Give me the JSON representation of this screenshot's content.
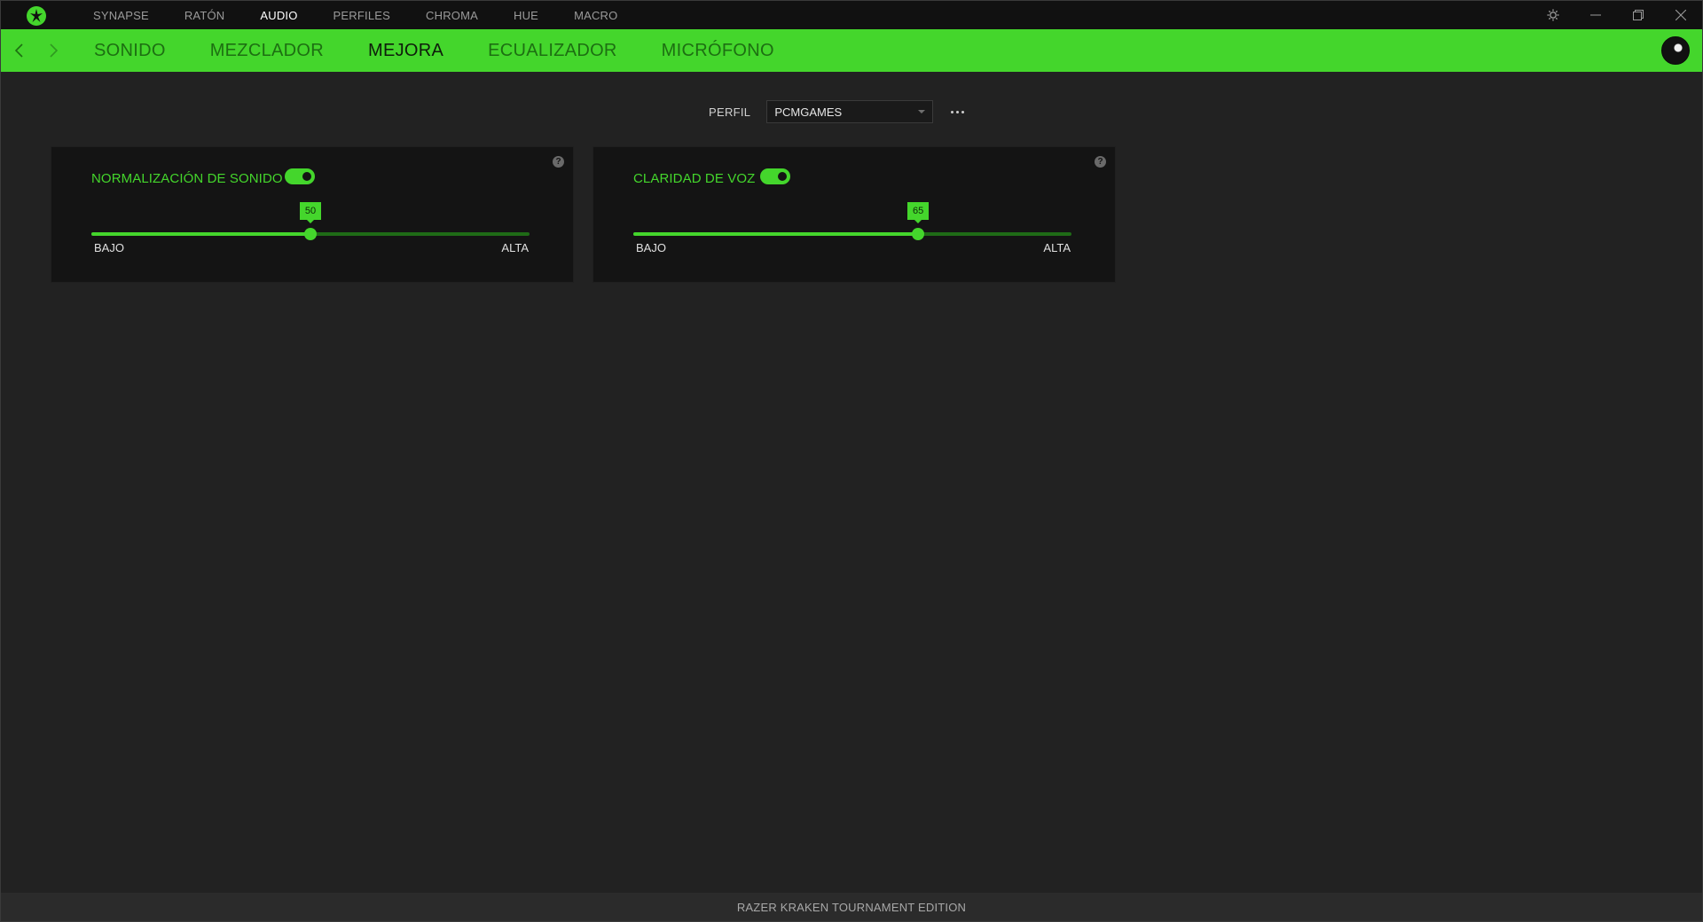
{
  "topnav": {
    "items": [
      {
        "label": "SYNAPSE",
        "active": false
      },
      {
        "label": "RATÓN",
        "active": false
      },
      {
        "label": "AUDIO",
        "active": true
      },
      {
        "label": "PERFILES",
        "active": false
      },
      {
        "label": "CHROMA",
        "active": false
      },
      {
        "label": "HUE",
        "active": false
      },
      {
        "label": "MACRO",
        "active": false
      }
    ]
  },
  "subnav": {
    "tabs": [
      {
        "label": "SONIDO",
        "active": false
      },
      {
        "label": "MEZCLADOR",
        "active": false
      },
      {
        "label": "MEJORA",
        "active": true
      },
      {
        "label": "ECUALIZADOR",
        "active": false
      },
      {
        "label": "MICRÓFONO",
        "active": false
      }
    ]
  },
  "profile": {
    "label": "PERFIL",
    "selected": "PCMGAMES"
  },
  "cards": [
    {
      "title": "NORMALIZACIÓN DE SONIDO",
      "enabled": true,
      "value": 50,
      "value_label": "50",
      "low_label": "BAJO",
      "high_label": "ALTA",
      "help": "?"
    },
    {
      "title": "CLARIDAD DE VOZ",
      "enabled": true,
      "value": 65,
      "value_label": "65",
      "low_label": "BAJO",
      "high_label": "ALTA",
      "help": "?"
    }
  ],
  "status": {
    "device": "RAZER KRAKEN TOURNAMENT EDITION"
  },
  "colors": {
    "accent": "#44d62c",
    "background": "#222222",
    "card": "#141414"
  }
}
